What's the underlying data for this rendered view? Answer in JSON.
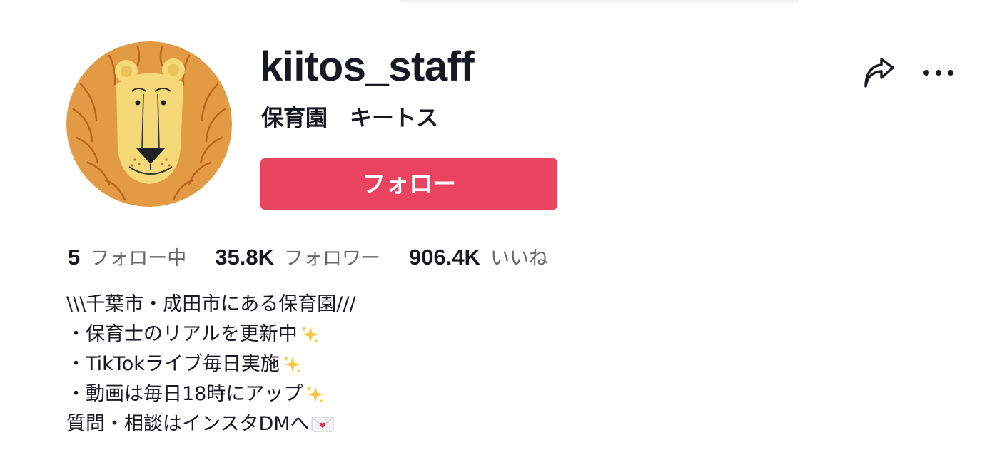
{
  "profile": {
    "username": "kiitos_staff",
    "nickname": "保育園　キートス",
    "follow_label": "フォロー"
  },
  "icons": {
    "share": "share-arrow-icon",
    "more": "more-horizontal-icon",
    "sparkle": "sparkles-icon",
    "mail": "love-letter-icon"
  },
  "stats": [
    {
      "value": "5",
      "label": "フォロー中"
    },
    {
      "value": "35.8K",
      "label": "フォロワー"
    },
    {
      "value": "906.4K",
      "label": "いいね"
    }
  ],
  "bio": {
    "line1": "\\\\\\千葉市・成田市にある保育園///",
    "line2": "・保育士のリアルを更新中",
    "line3": "・TikTokライブ毎日実施",
    "line4": "・動画は毎日18時にアップ",
    "line5": "質問・相談はインスタDMへ"
  },
  "colors": {
    "follow_button": "#e9435f",
    "primary_text": "#161823",
    "secondary_text": "#666870",
    "avatar_bg": "#e39a44",
    "lion_face": "#f5d877"
  }
}
